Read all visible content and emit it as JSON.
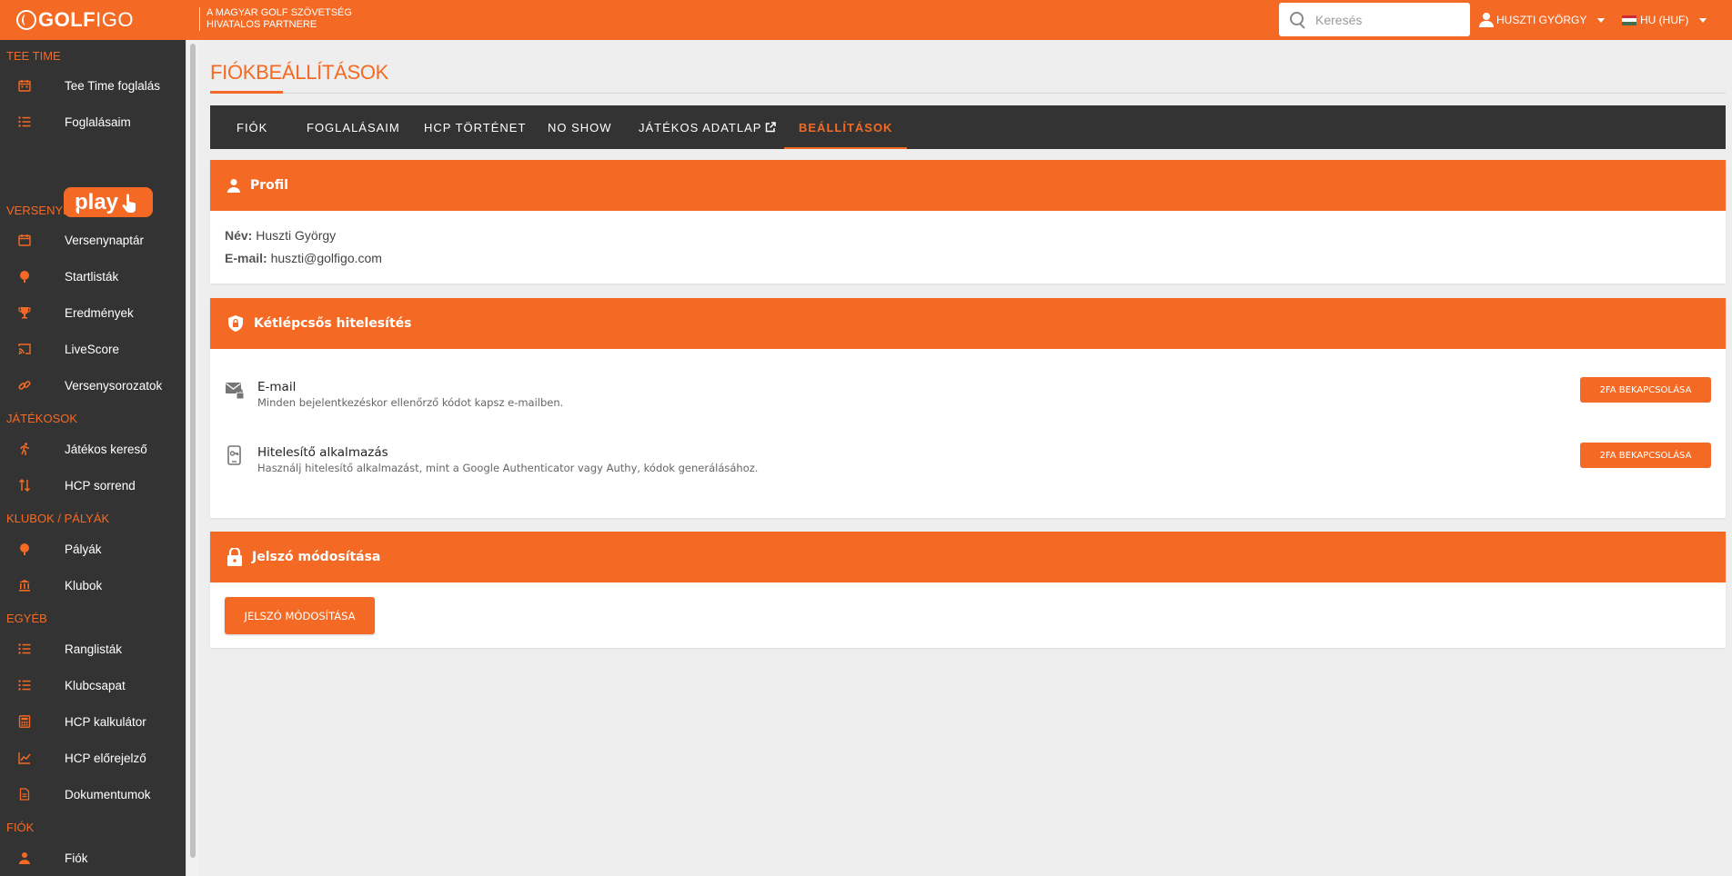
{
  "header": {
    "logo_text_bold": "GOLF",
    "logo_text_light": "IGO",
    "partner_line1": "A MAGYAR GOLF SZÖVETSÉG",
    "partner_line2": "HIVATALOS PARTNERE",
    "search_placeholder": "Keresés",
    "user_name": "HUSZTI GYÖRGY",
    "language": "HU (HUF)"
  },
  "colors": {
    "accent": "#f46a25",
    "dark": "#333333",
    "background": "#eeeeee"
  },
  "sidebar": {
    "sections": [
      {
        "title": "TEE TIME",
        "items": [
          {
            "label": "Tee Time foglalás",
            "icon": "calendar-icon"
          },
          {
            "label": "Foglalásaim",
            "icon": "list-icon"
          }
        ]
      },
      {
        "title": "VERSENYEK",
        "items": [
          {
            "label": "Versenynaptár",
            "icon": "calendar-icon"
          },
          {
            "label": "Startlisták",
            "icon": "golf-ball-icon"
          },
          {
            "label": "Eredmények",
            "icon": "trophy-icon"
          },
          {
            "label": "LiveScore",
            "icon": "cast-icon"
          },
          {
            "label": "Versenysorozatok",
            "icon": "link-icon"
          }
        ]
      },
      {
        "title": "JÁTÉKOSOK",
        "items": [
          {
            "label": "Játékos kereső",
            "icon": "running-icon"
          },
          {
            "label": "HCP sorrend",
            "icon": "sort-icon"
          }
        ]
      },
      {
        "title": "KLUBOK / PÁLYÁK",
        "items": [
          {
            "label": "Pályák",
            "icon": "golf-ball-icon"
          },
          {
            "label": "Klubok",
            "icon": "bank-icon"
          }
        ]
      },
      {
        "title": "EGYÉB",
        "items": [
          {
            "label": "Ranglisták",
            "icon": "list-icon"
          },
          {
            "label": "Klubcsapat",
            "icon": "list-icon"
          },
          {
            "label": "HCP kalkulátor",
            "icon": "calculator-icon"
          },
          {
            "label": "HCP előrejelző",
            "icon": "chart-icon"
          },
          {
            "label": "Dokumentumok",
            "icon": "document-icon"
          }
        ]
      },
      {
        "title": "FIÓK",
        "items": [
          {
            "label": "Fiók",
            "icon": "user-icon"
          }
        ]
      }
    ],
    "play_label": "play"
  },
  "main": {
    "title": "FIÓKBEÁLLÍTÁSOK",
    "tabs": [
      {
        "label": "FIÓK"
      },
      {
        "label": "FOGLALÁSAIM"
      },
      {
        "label": "HCP TÖRTÉNET"
      },
      {
        "label": "NO SHOW"
      },
      {
        "label": "JÁTÉKOS ADATLAP"
      },
      {
        "label": "BEÁLLÍTÁSOK",
        "active": true
      }
    ],
    "profile": {
      "heading": "Profil",
      "name_label": "Név:",
      "name_value": "Huszti György",
      "email_label": "E-mail:",
      "email_value": "huszti@golfigo.com"
    },
    "two_factor": {
      "heading": "Kétlépcsős hitelesítés",
      "methods": [
        {
          "title": "E-mail",
          "description": "Minden bejelentkezéskor ellenőrző kódot kapsz e-mailben.",
          "button": "2FA BEKAPCSOLÁSA"
        },
        {
          "title": "Hitelesítő alkalmazás",
          "description": "Használj hitelesítő alkalmazást, mint a Google Authenticator vagy Authy, kódok generálásához.",
          "button": "2FA BEKAPCSOLÁSA"
        }
      ]
    },
    "password": {
      "heading": "Jelszó módosítása",
      "button": "JELSZÓ MÓDOSÍTÁSA"
    }
  }
}
